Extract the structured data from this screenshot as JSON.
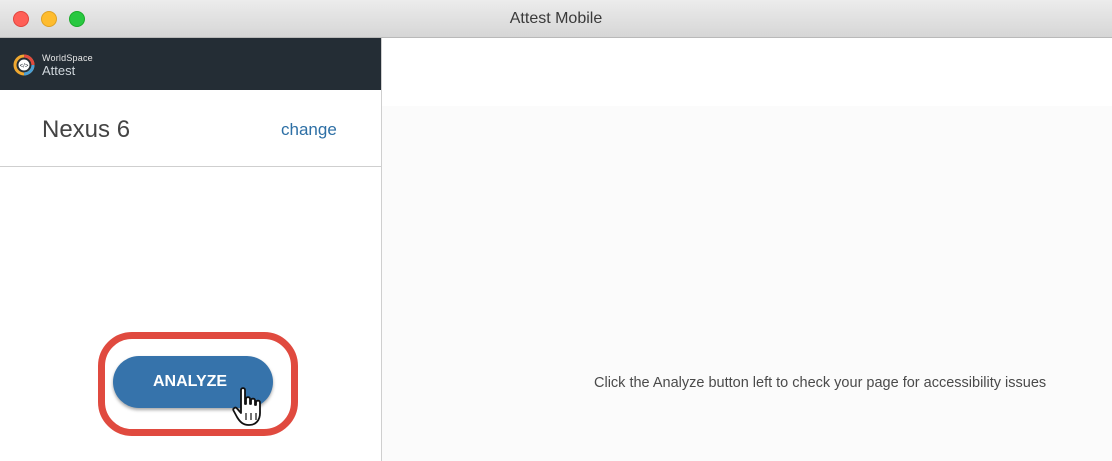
{
  "window": {
    "title": "Attest Mobile"
  },
  "sidebar": {
    "brand": {
      "top_text": "WorldSpace",
      "bottom_text": "Attest",
      "icon": "worldspace-logo-icon"
    },
    "device": {
      "name": "Nexus 6",
      "change_label": "change"
    },
    "analyze_label": "ANALYZE"
  },
  "main": {
    "hint": "Click the Analyze button left to check your page for accessibility issues"
  },
  "colors": {
    "brand_bar": "#242d35",
    "accent": "#3673ab",
    "highlight": "#e04a3f",
    "link": "#2d6fa5"
  },
  "icons": {
    "pointer": "hand-pointer-icon"
  }
}
